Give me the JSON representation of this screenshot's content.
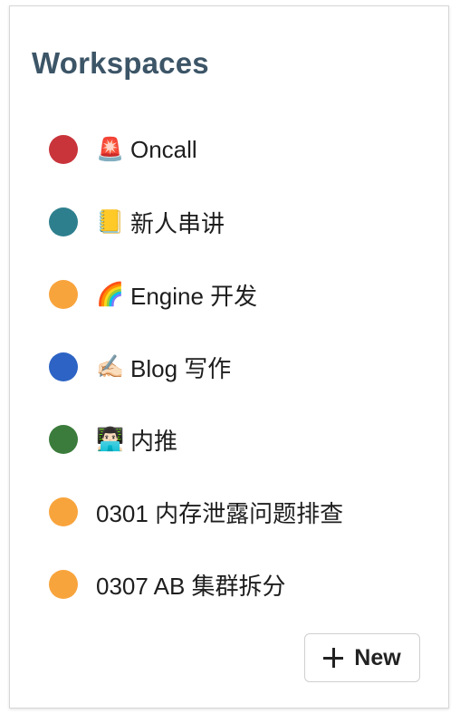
{
  "panel": {
    "title": "Workspaces"
  },
  "workspaces": [
    {
      "icon": "🚨",
      "icon_name": "siren-icon",
      "name": "Oncall",
      "color": "#c9343b"
    },
    {
      "icon": "📒",
      "icon_name": "notebook-icon",
      "name": "新人串讲",
      "color": "#2e7f8e"
    },
    {
      "icon": "🌈",
      "icon_name": "rainbow-icon",
      "name": "Engine 开发",
      "color": "#f8a43c"
    },
    {
      "icon": "✍🏻",
      "icon_name": "writing-hand-icon",
      "name": "Blog 写作",
      "color": "#2c63c4"
    },
    {
      "icon": "👨🏻‍💻",
      "icon_name": "technologist-icon",
      "name": "内推",
      "color": "#3b7c3c"
    },
    {
      "icon": "",
      "icon_name": "",
      "name": "0301 内存泄露问题排查",
      "color": "#f8a43c"
    },
    {
      "icon": "",
      "icon_name": "",
      "name": "0307 AB 集群拆分",
      "color": "#f8a43c"
    }
  ],
  "new_button": {
    "label": "New",
    "icon_name": "plus-icon"
  }
}
